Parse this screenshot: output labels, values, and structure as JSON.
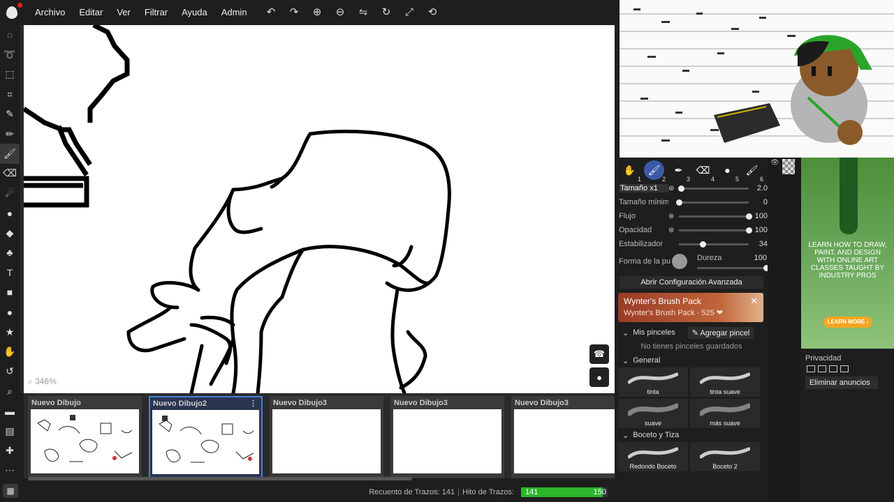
{
  "app": {
    "accent": "#4a7fd8",
    "logo": "drop-logo"
  },
  "menu": [
    "Archivo",
    "Editar",
    "Ver",
    "Filtrar",
    "Ayuda",
    "Admin"
  ],
  "toolbar_top": [
    {
      "name": "undo-icon",
      "glyph": "↶"
    },
    {
      "name": "redo-icon",
      "glyph": "↷"
    },
    {
      "name": "zoom-in-icon",
      "glyph": "⊕"
    },
    {
      "name": "zoom-out-icon",
      "glyph": "⊖"
    },
    {
      "name": "flip-icon",
      "glyph": "⇋"
    },
    {
      "name": "rotate-icon",
      "glyph": "↻"
    },
    {
      "name": "fullscreen-icon",
      "glyph": "⤢"
    },
    {
      "name": "rotate-reset-icon",
      "glyph": "⟲"
    }
  ],
  "tools": [
    {
      "name": "lasso-select-icon",
      "glyph": "◌"
    },
    {
      "name": "lasso-icon",
      "glyph": "➰"
    },
    {
      "name": "transform-icon",
      "glyph": "⬚"
    },
    {
      "name": "crop-icon",
      "glyph": "⌗"
    },
    {
      "name": "eyedropper-icon",
      "glyph": "✎"
    },
    {
      "name": "pencil-icon",
      "glyph": "✏"
    },
    {
      "name": "brush-icon",
      "glyph": "🖌",
      "active": true
    },
    {
      "name": "eraser-icon",
      "glyph": "⌫"
    },
    {
      "name": "smudge-icon",
      "glyph": "☄"
    },
    {
      "name": "blur-icon",
      "glyph": "●"
    },
    {
      "name": "fill-bucket-icon",
      "glyph": "◆"
    },
    {
      "name": "stamp-icon",
      "glyph": "♣"
    },
    {
      "name": "text-icon",
      "glyph": "T"
    },
    {
      "name": "rectangle-icon",
      "glyph": "■"
    },
    {
      "name": "ellipse-icon",
      "glyph": "●"
    },
    {
      "name": "star-icon",
      "glyph": "★"
    },
    {
      "name": "hand-icon",
      "glyph": "✋"
    },
    {
      "name": "rotate-view-icon",
      "glyph": "↺"
    },
    {
      "name": "zoom-icon",
      "glyph": "⌕"
    },
    {
      "name": "chat-icon",
      "glyph": "▬"
    },
    {
      "name": "gallery-icon",
      "glyph": "▤"
    },
    {
      "name": "add-icon",
      "glyph": "✚"
    },
    {
      "name": "more-icon",
      "glyph": "⋯"
    }
  ],
  "canvas": {
    "zoom": "346%"
  },
  "thumbnails": [
    {
      "title": "Nuevo Dibujo",
      "selected": false
    },
    {
      "title": "Nuevo Dibujo2",
      "selected": true
    },
    {
      "title": "Nuevo Dibujo3",
      "selected": false
    },
    {
      "title": "Nuevo Dibujo3",
      "selected": false
    },
    {
      "title": "Nuevo Dibujo3",
      "selected": false
    }
  ],
  "status": {
    "stroke_count_label": "Recuento de Trazos: 141",
    "stroke_goal_label": "Hito de Trazos:",
    "progress_current": "141",
    "progress_target": "150",
    "progress_fraction": 0.94
  },
  "brush_slots": [
    {
      "name": "hand-icon",
      "glyph": "✋",
      "num": "1"
    },
    {
      "name": "brush-icon",
      "glyph": "🖌",
      "num": "2",
      "active": true
    },
    {
      "name": "pen-icon",
      "glyph": "✒",
      "num": "3"
    },
    {
      "name": "eraser-icon",
      "glyph": "⌫",
      "num": "4"
    },
    {
      "name": "round-brush-icon",
      "glyph": "●",
      "num": "5"
    },
    {
      "name": "brush-icon",
      "glyph": "🖌",
      "num": "6"
    }
  ],
  "settings": [
    {
      "label": "Tamaño x1",
      "pen": true,
      "value": "2.0",
      "knob": 0.02,
      "highlight": true
    },
    {
      "label": "Tamaño mínimo",
      "pen": false,
      "value": "0",
      "knob": 0.0
    },
    {
      "label": "Flujo",
      "pen": true,
      "value": "100",
      "knob": 1.0
    },
    {
      "label": "Opacidad",
      "pen": true,
      "value": "100",
      "knob": 1.0
    },
    {
      "label": "Estabilizador",
      "pen": false,
      "value": "34",
      "knob": 0.34
    }
  ],
  "tip": {
    "label": "Forma de la punta",
    "hardness_label": "Dureza",
    "hardness_value": "100"
  },
  "advanced_button": "Abrir Configuración Avanzada",
  "promo": {
    "title": "Wynter's Brush Pack",
    "subtitle": "Wynter's Brush Pack · 525 ❤"
  },
  "my_brushes": {
    "title": "Mis pinceles",
    "add": "Agregar pincel",
    "empty": "No tienes pinceles guardados"
  },
  "groups": [
    {
      "title": "General",
      "brushes": [
        "tinta",
        "tinta suave",
        "suave",
        "más suave"
      ]
    },
    {
      "title": "Boceto y Tiza",
      "brushes": [
        "Redondo Boceto",
        "Boceto 2"
      ]
    }
  ],
  "ad": {
    "text": "LEARN HOW TO DRAW, PAINT, AND DESIGN WITH ONLINE ART CLASSES TAUGHT BY INDUSTRY PROS",
    "button": "LEARN MORE ›"
  },
  "privacy": {
    "label": "Privacidad",
    "remove_ads": "Eliminar anuncios"
  }
}
